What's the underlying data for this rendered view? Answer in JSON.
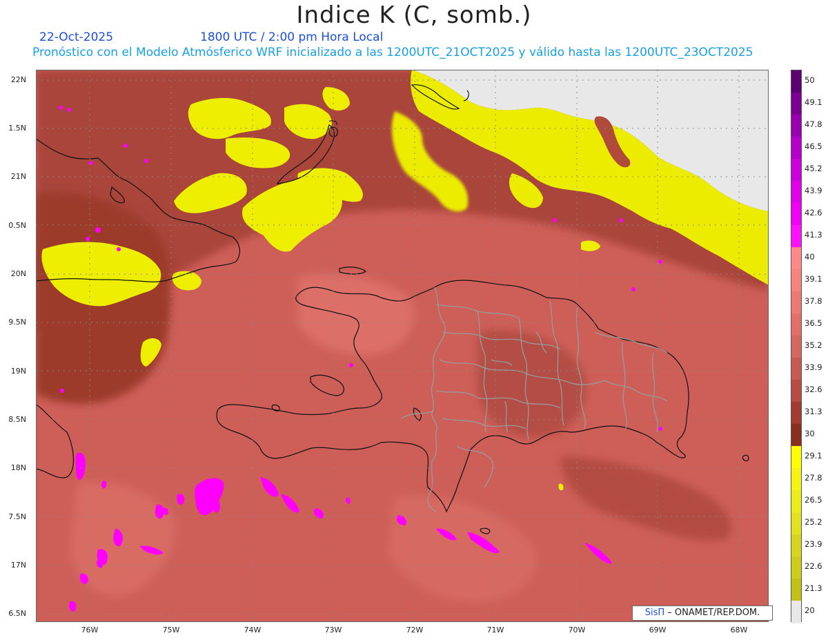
{
  "title": "Indice K (C, somb.)",
  "header": {
    "date": "22-Oct-2025",
    "time": "1800 UTC / 2:00 pm Hora Local",
    "forecast": "Pronóstico con el Modelo Atmósferico WRF inicializado a las 1200UTC_21OCT2025 y válido hasta las  1200UTC_23OCT2025"
  },
  "axes": {
    "lat_labels": [
      "22N",
      "1.5N",
      "21N",
      "0.5N",
      "20N",
      "9.5N",
      "19N",
      "8.5N",
      "18N",
      "7.5N",
      "17N",
      "6.5N"
    ],
    "lon_labels": [
      "76W",
      "75W",
      "74W",
      "73W",
      "72W",
      "71W",
      "70W",
      "69W",
      "68W"
    ]
  },
  "colorbar": {
    "labels": [
      "50",
      "49.1",
      "47.8",
      "46.5",
      "45.2",
      "43.9",
      "42.6",
      "41.3",
      "40",
      "39.1",
      "37.8",
      "36.5",
      "35.2",
      "33.9",
      "32.6",
      "31.3",
      "30",
      "29.1",
      "27.8",
      "26.5",
      "25.2",
      "23.9",
      "22.6",
      "21.3",
      "20"
    ],
    "colors": [
      "#5c0072",
      "#7d0094",
      "#9a00b0",
      "#b400c8",
      "#cc00dc",
      "#e000ea",
      "#f000f4",
      "#ff10ff",
      "#ff8888",
      "#f4847c",
      "#ec7a72",
      "#e2706a",
      "#d66660",
      "#c85a52",
      "#b84c44",
      "#a23c30",
      "#8a2e1e",
      "#ffff00",
      "#f4f415",
      "#ecec1c",
      "#e2e220",
      "#d6d620",
      "#cccc1c",
      "#c0c018",
      "#e8e8e8"
    ]
  },
  "credit": {
    "brand": "SisΠ",
    "text": "– ONAMET/REP.DOM."
  },
  "colors": {
    "land_base": "#d0625a",
    "dark": "#9e3c2c",
    "yellow": "#eeee00",
    "magenta": "#ff00ff",
    "nodata": "#e8e8e8"
  }
}
